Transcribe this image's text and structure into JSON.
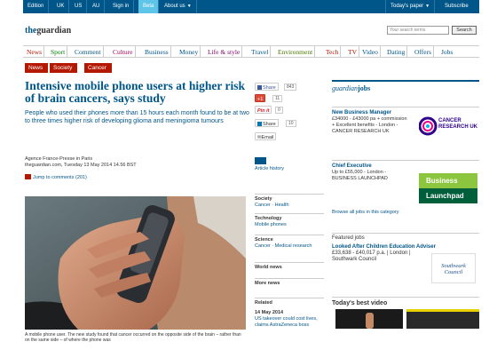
{
  "topbar": {
    "items": [
      "Edition",
      "UK",
      "US",
      "AU",
      "Sign in",
      "Beta",
      "About us"
    ],
    "todays_paper": "Today's paper",
    "subscribe": "Subscribe"
  },
  "brand": {
    "the": "the",
    "name": "guardian"
  },
  "search": {
    "placeholder": "Your search terms",
    "button": "Search"
  },
  "nav": [
    "News",
    "Sport",
    "Comment",
    "Culture",
    "Business",
    "Money",
    "Life & style",
    "Travel",
    "Environment",
    "Tech",
    "TV",
    "Video",
    "Dating",
    "Offers",
    "Jobs"
  ],
  "breadcrumbs": [
    "News",
    "Society",
    "Cancer"
  ],
  "article": {
    "headline": "Intensive mobile phone users at higher risk of brain cancers, says study",
    "standfirst": "People who used their phones more than 15 hours each month found to be at two to three times higher risk of developing glioma and meningioma tumours",
    "byline_source": "Agence France-Presse in Paris",
    "byline_date": "theguardian.com, Tuesday 13 May 2014 14.56 BST",
    "jump_to_comments": "Jump to comments (201)",
    "caption": "A mobile phone user. The new study found that cancer occurred on the opposite side of the brain – rather than on the same side – of where the phone was"
  },
  "share": {
    "facebook": {
      "label": "Share",
      "count": "843"
    },
    "gplus": {
      "label": "+1",
      "count": "11"
    },
    "pinterest": {
      "label": "Pin it",
      "count": "0"
    },
    "linkedin": {
      "label": "Share",
      "count": "10"
    },
    "email": "Email"
  },
  "midcol": {
    "article_history": "Article history",
    "sections": [
      {
        "title": "Society",
        "links": "Cancer · Health"
      },
      {
        "title": "Technology",
        "links": "Mobile phones"
      },
      {
        "title": "Science",
        "links": "Cancer · Medical research"
      },
      {
        "title": "World news",
        "links": ""
      },
      {
        "title": "More news",
        "links": ""
      }
    ],
    "related_label": "Related",
    "related_date": "14 May 2014",
    "related_link": "US takeover could cost lives, claims AstraZeneca boss"
  },
  "jobs": {
    "header_guardian": "guardian",
    "header_jobs": "jobs",
    "items": [
      {
        "title": "New Business Manager",
        "desc": "£34000 - £43000 pa + commission + Excellent benefits - London - CANCER RESEARCH UK",
        "logo": "CANCER RESEARCH UK"
      },
      {
        "title": "Chief Executive",
        "desc": "Up to £55,000 - London - BUSINESS LAUNCHPAD",
        "logo_top": "Business",
        "logo_bottom": "Launchpad"
      }
    ],
    "browse_all": "Browse all jobs in this category"
  },
  "featured": {
    "heading": "Featured jobs",
    "title": "Looked After Children Education Adviser",
    "desc": "£33,638 - £40,017 p.a. | London | Southwark Council",
    "logo": "Southwark Council"
  },
  "best_video": {
    "heading": "Today's best video"
  },
  "colors": {
    "brand_blue": "#005689",
    "breadcrumb_red": "#b51800",
    "beta_cyan": "#5ec4e8"
  }
}
